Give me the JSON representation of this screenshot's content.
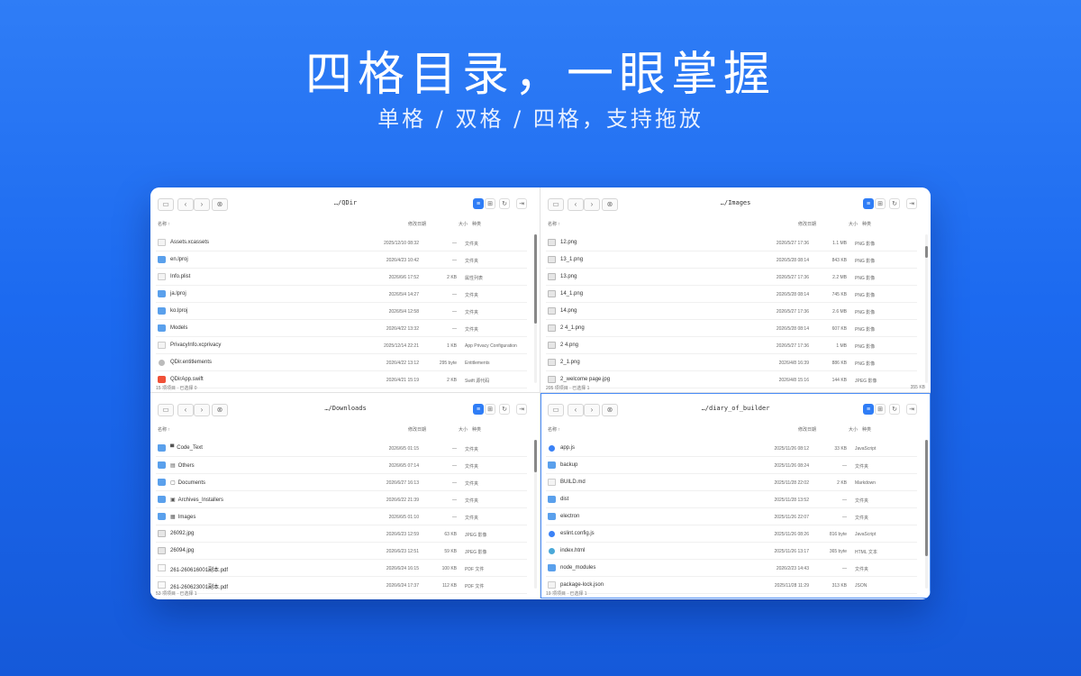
{
  "hero": {
    "title": "四格目录，一眼掌握",
    "subtitle": "单格 / 双格 / 四格，支持拖放"
  },
  "columns": {
    "name": "名称 ↑",
    "date": "修改日期",
    "size": "大小",
    "kind": "种类"
  },
  "panes": [
    {
      "path": "…/QDir",
      "status": "15 项项目 · 已选择 0",
      "status_right": "",
      "rows": [
        {
          "name": "Assets.xcassets",
          "date": "2025/12/10 08:32",
          "size": "—",
          "kind": "文件夹",
          "icon": "file"
        },
        {
          "name": "en.lproj",
          "date": "2026/4/23 10:42",
          "size": "—",
          "kind": "文件夹",
          "icon": "folder"
        },
        {
          "name": "Info.plist",
          "date": "2026/6/6 17:52",
          "size": "2 KB",
          "kind": "属性列表",
          "icon": "file"
        },
        {
          "name": "ja.lproj",
          "date": "2026/5/4 14:27",
          "size": "—",
          "kind": "文件夹",
          "icon": "folder"
        },
        {
          "name": "ko.lproj",
          "date": "2026/5/4 12:58",
          "size": "—",
          "kind": "文件夹",
          "icon": "folder"
        },
        {
          "name": "Models",
          "date": "2026/4/22 13:32",
          "size": "—",
          "kind": "文件夹",
          "icon": "folder"
        },
        {
          "name": "PrivacyInfo.xcprivacy",
          "date": "2025/12/14 22:21",
          "size": "1 KB",
          "kind": "App Privacy Configuration",
          "icon": "file"
        },
        {
          "name": "QDir.entitlements",
          "date": "2026/4/22 13:12",
          "size": "295 byte",
          "kind": "Entitlements",
          "icon": "gear"
        },
        {
          "name": "QDirApp.swift",
          "date": "2026/4/21 15:19",
          "size": "2 KB",
          "kind": "Swift 源代码",
          "icon": "swift"
        }
      ]
    },
    {
      "path": "…/Images",
      "status": "205 项项目 · 已选择 1",
      "status_right": "355 KB",
      "rows": [
        {
          "name": "12.png",
          "date": "2026/5/27 17:36",
          "size": "1.1 MB",
          "kind": "PNG 影像",
          "icon": "img"
        },
        {
          "name": "13_1.png",
          "date": "2026/5/28 08:14",
          "size": "843 KB",
          "kind": "PNG 影像",
          "icon": "img"
        },
        {
          "name": "13.png",
          "date": "2026/5/27 17:36",
          "size": "2.2 MB",
          "kind": "PNG 影像",
          "icon": "img"
        },
        {
          "name": "14_1.png",
          "date": "2026/5/28 08:14",
          "size": "745 KB",
          "kind": "PNG 影像",
          "icon": "img"
        },
        {
          "name": "14.png",
          "date": "2026/5/27 17:36",
          "size": "2.6 MB",
          "kind": "PNG 影像",
          "icon": "img"
        },
        {
          "name": "2 4_1.png",
          "date": "2026/5/28 08:14",
          "size": "607 KB",
          "kind": "PNG 影像",
          "icon": "img"
        },
        {
          "name": "2 4.png",
          "date": "2026/5/27 17:36",
          "size": "1 MB",
          "kind": "PNG 影像",
          "icon": "img"
        },
        {
          "name": "2_1.png",
          "date": "2026/4/8 16:39",
          "size": "886 KB",
          "kind": "PNG 影像",
          "icon": "img"
        },
        {
          "name": "2_welcome page.jpg",
          "date": "2026/4/8 15:16",
          "size": "144 KB",
          "kind": "JPEG 影像",
          "icon": "img"
        }
      ]
    },
    {
      "path": "…/Downloads",
      "status": "53 项项目 · 已选择 1",
      "status_right": "",
      "rows": [
        {
          "name": "Code_Text",
          "date": "2026/6/5 01:15",
          "size": "—",
          "kind": "文件夹",
          "icon": "folder",
          "badge": "▀"
        },
        {
          "name": "Others",
          "date": "2026/6/5 07:14",
          "size": "—",
          "kind": "文件夹",
          "icon": "folder",
          "badge": "▤"
        },
        {
          "name": "Documents",
          "date": "2026/6/27 16:13",
          "size": "—",
          "kind": "文件夹",
          "icon": "folder",
          "badge": "▢"
        },
        {
          "name": "Archives_Installers",
          "date": "2026/6/22 21:39",
          "size": "—",
          "kind": "文件夹",
          "icon": "folder",
          "badge": "▣"
        },
        {
          "name": "Images",
          "date": "2026/6/5 01:10",
          "size": "—",
          "kind": "文件夹",
          "icon": "folder",
          "badge": "▦"
        },
        {
          "name": "26092.jpg",
          "date": "2026/6/23 12:59",
          "size": "63 KB",
          "kind": "JPEG 影像",
          "icon": "img"
        },
        {
          "name": "26094.jpg",
          "date": "2026/6/23 12:51",
          "size": "59 KB",
          "kind": "JPEG 影像",
          "icon": "img"
        },
        {
          "name": "261-260616001副本.pdf",
          "date": "2026/6/24 16:15",
          "size": "100 KB",
          "kind": "PDF 文件",
          "icon": "pdf"
        },
        {
          "name": "261-260623001副本.pdf",
          "date": "2026/6/24 17:37",
          "size": "112 KB",
          "kind": "PDF 文件",
          "icon": "pdf"
        }
      ]
    },
    {
      "path": "…/diary_of_builder",
      "status": "19 项项目 · 已选择 1",
      "status_right": "",
      "rows": [
        {
          "name": "app.js",
          "date": "2025/11/26 08:12",
          "size": "33 KB",
          "kind": "JavaScript",
          "icon": "js"
        },
        {
          "name": "backup",
          "date": "2025/11/26 08:24",
          "size": "—",
          "kind": "文件夹",
          "icon": "folder"
        },
        {
          "name": "BUILD.md",
          "date": "2025/11/28 22:02",
          "size": "2 KB",
          "kind": "Markdown",
          "icon": "file"
        },
        {
          "name": "dist",
          "date": "2025/11/28 13:52",
          "size": "—",
          "kind": "文件夹",
          "icon": "folder"
        },
        {
          "name": "electron",
          "date": "2025/11/26 22:07",
          "size": "—",
          "kind": "文件夹",
          "icon": "folder"
        },
        {
          "name": "eslint.config.js",
          "date": "2025/11/26 08:26",
          "size": "816 byte",
          "kind": "JavaScript",
          "icon": "js"
        },
        {
          "name": "index.html",
          "date": "2025/11/26 13:17",
          "size": "365 byte",
          "kind": "HTML 文本",
          "icon": "html"
        },
        {
          "name": "node_modules",
          "date": "2026/2/23 14:43",
          "size": "—",
          "kind": "文件夹",
          "icon": "folder"
        },
        {
          "name": "package-lock.json",
          "date": "2025/11/28 11:29",
          "size": "313 KB",
          "kind": "JSON",
          "icon": "file"
        }
      ]
    }
  ],
  "scroll": [
    {
      "top": 0.0,
      "size": 0.6
    },
    {
      "top": 0.08,
      "size": 0.08
    },
    {
      "top": 0.0,
      "size": 0.22
    },
    {
      "top": 0.0,
      "size": 0.78
    }
  ],
  "icons": {
    "folder": "folder-icon",
    "back": "chevron-left-icon",
    "forward": "chevron-right-icon",
    "close": "close-circle-icon",
    "list_view": "list-view-icon",
    "grid_view": "grid-view-icon",
    "refresh": "refresh-icon",
    "open": "open-folder-icon"
  }
}
